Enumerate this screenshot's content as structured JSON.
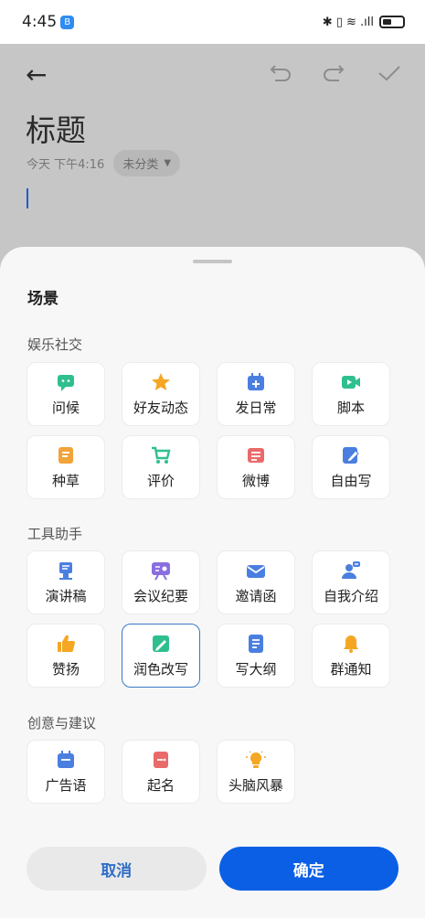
{
  "status": {
    "time": "4:45",
    "app_badge": "B",
    "indicators": "✱ ▯ ≋ .ıll"
  },
  "editor": {
    "back_icon": "←",
    "undo_icon": "undo-icon",
    "redo_icon": "redo-icon",
    "check_icon": "check-icon",
    "title": "标题",
    "date": "今天 下午4:16",
    "category": "未分类",
    "category_caret": "▼"
  },
  "sheet": {
    "title": "场景",
    "sections": [
      {
        "title": "娱乐社交",
        "items": [
          {
            "label": "问候",
            "icon": "chat-icon",
            "color": "#2fbf8f"
          },
          {
            "label": "好友动态",
            "icon": "star-icon",
            "color": "#f5a623"
          },
          {
            "label": "发日常",
            "icon": "calendar-add-icon",
            "color": "#4a7fe0"
          },
          {
            "label": "脚本",
            "icon": "video-icon",
            "color": "#2fbf8f"
          },
          {
            "label": "种草",
            "icon": "note-icon",
            "color": "#f2a33a"
          },
          {
            "label": "评价",
            "icon": "cart-icon",
            "color": "#2fbf8f"
          },
          {
            "label": "微博",
            "icon": "list-icon",
            "color": "#ea6a6a"
          },
          {
            "label": "自由写",
            "icon": "edit-icon",
            "color": "#4a7fe0"
          }
        ]
      },
      {
        "title": "工具助手",
        "items": [
          {
            "label": "演讲稿",
            "icon": "podium-icon",
            "color": "#4a7fe0"
          },
          {
            "label": "会议纪要",
            "icon": "presentation-icon",
            "color": "#8a6ee0"
          },
          {
            "label": "邀请函",
            "icon": "envelope-icon",
            "color": "#4a7fe0"
          },
          {
            "label": "自我介绍",
            "icon": "person-icon",
            "color": "#4a7fe0"
          },
          {
            "label": "赞扬",
            "icon": "thumbs-up-icon",
            "color": "#f5a623"
          },
          {
            "label": "润色改写",
            "icon": "pencil-note-icon",
            "color": "#2fbf8f",
            "selected": true
          },
          {
            "label": "写大纲",
            "icon": "outline-icon",
            "color": "#4a7fe0"
          },
          {
            "label": "群通知",
            "icon": "bell-icon",
            "color": "#f5a623"
          }
        ]
      },
      {
        "title": "创意与建议",
        "items": [
          {
            "label": "广告语",
            "icon": "calendar-icon",
            "color": "#4a7fe0"
          },
          {
            "label": "起名",
            "icon": "name-tag-icon",
            "color": "#ea6a6a"
          },
          {
            "label": "头脑风暴",
            "icon": "lightbulb-icon",
            "color": "#f5a623"
          }
        ]
      }
    ],
    "cancel_label": "取消",
    "confirm_label": "确定"
  }
}
